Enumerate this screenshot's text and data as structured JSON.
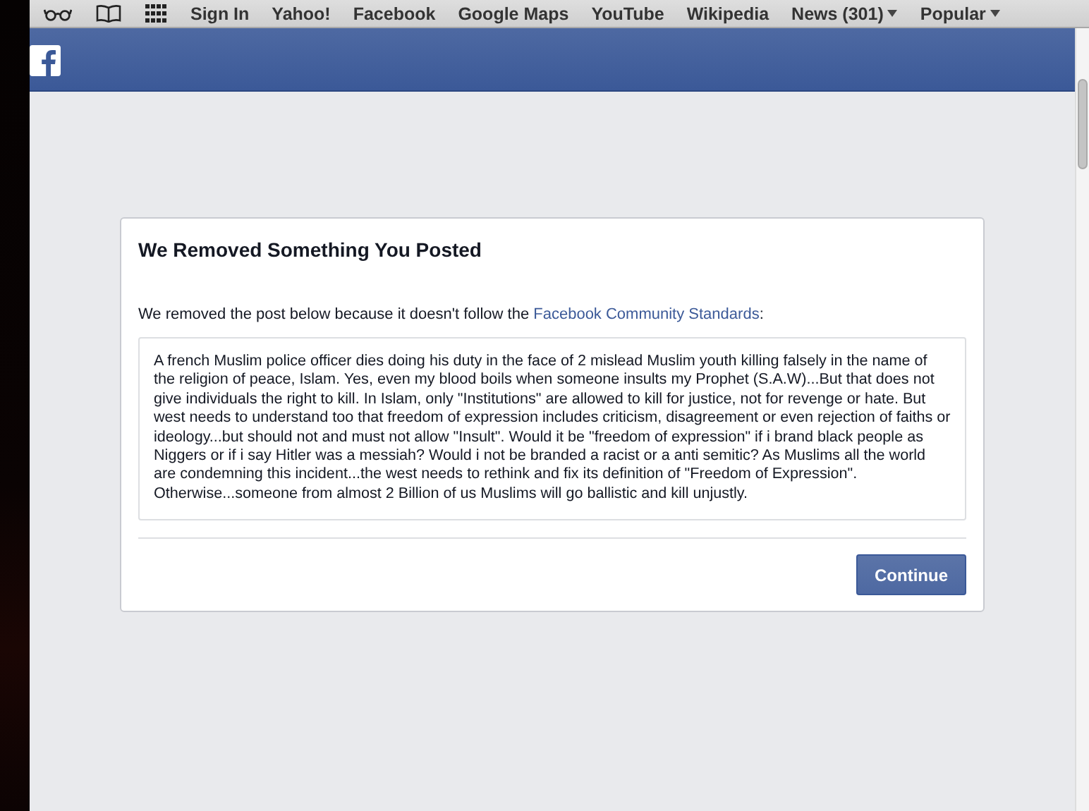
{
  "bookmarks_bar": {
    "items": [
      {
        "label": "Sign In",
        "kind": "link"
      },
      {
        "label": "Yahoo!",
        "kind": "link"
      },
      {
        "label": "Facebook",
        "kind": "link"
      },
      {
        "label": "Google Maps",
        "kind": "link"
      },
      {
        "label": "YouTube",
        "kind": "link"
      },
      {
        "label": "Wikipedia",
        "kind": "link"
      },
      {
        "label": "News (301)",
        "kind": "folder"
      },
      {
        "label": "Popular",
        "kind": "folder"
      }
    ]
  },
  "dialog": {
    "title": "We Removed Something You Posted",
    "message": "We removed the post below because it doesn't follow the ",
    "link": "Facebook Community Standards",
    "message_end": ":",
    "post": "A french Muslim police officer dies doing his duty in the face of 2 mislead Muslim youth killing falsely in the name of the religion of peace, Islam. Yes, even my blood boils when someone insults my Prophet (S.A.W)...But that does not give individuals the right to kill. In Islam, only \"Institutions\" are allowed to kill for justice, not for revenge or hate. But west needs to understand too that freedom of expression includes criticism, disagreement or even rejection of faiths or ideology...but should not and must not allow \"Insult\". Would it be \"freedom of expression\" if i brand black people as Niggers or if i say Hitler was a messiah? Would i not be branded a racist or a anti semitic? As Muslims all the world are condemning this incident...the west needs to rethink and fix its definition of \"Freedom of Expression\". Otherwise...someone from almost 2 Billion of us Muslims will go ballistic and kill unjustly.",
    "button": "Continue"
  }
}
